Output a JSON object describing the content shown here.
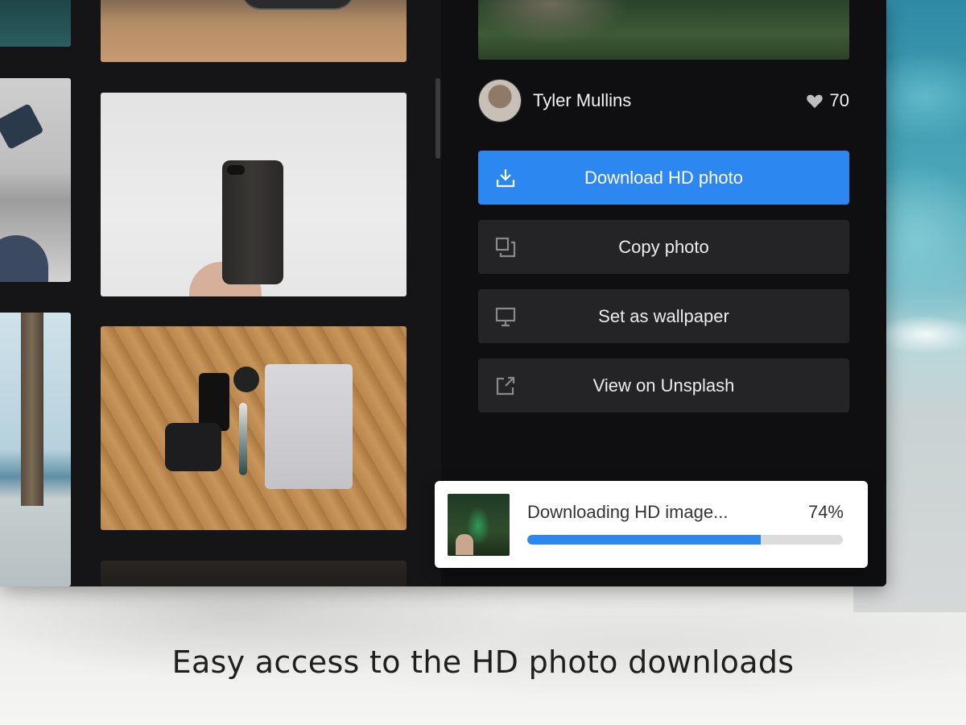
{
  "detail": {
    "author_name": "Tyler Mullins",
    "likes_count": "70",
    "actions": [
      {
        "label": "Download HD photo",
        "icon": "download-icon"
      },
      {
        "label": "Copy photo",
        "icon": "copy-icon"
      },
      {
        "label": "Set as wallpaper",
        "icon": "monitor-icon"
      },
      {
        "label": "View on Unsplash",
        "icon": "external-link-icon"
      }
    ]
  },
  "toast": {
    "label": "Downloading HD image...",
    "percent_text": "74%",
    "progress": 0.74
  },
  "caption": "Easy access to the HD photo downloads",
  "colors": {
    "accent": "#2d87f0",
    "button_bg": "#242427",
    "window_bg": "#151518"
  }
}
